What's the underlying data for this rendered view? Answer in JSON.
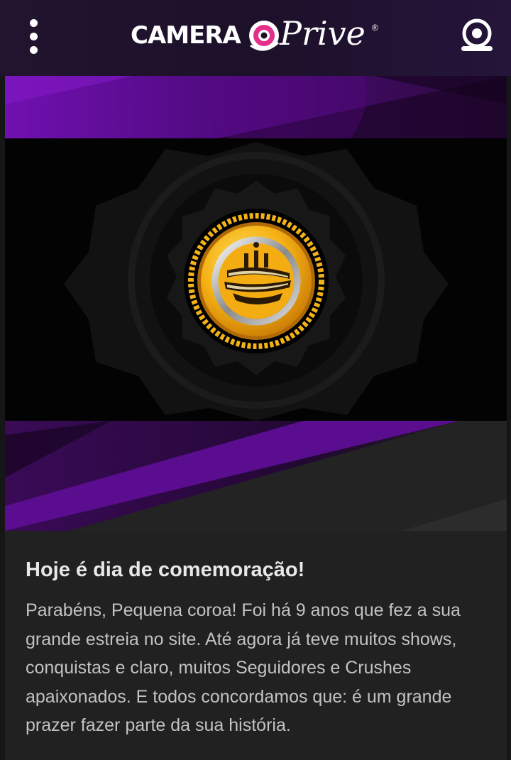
{
  "header": {
    "menu_icon": "vertical-dots-icon",
    "logo_left": "CAMERA",
    "logo_right": "Prive",
    "logo_registered": "®",
    "webcam_icon": "webcam-icon"
  },
  "banner": {
    "badge_icon": "gold-crown-coin-badge"
  },
  "article": {
    "title": "Hoje é dia de comemoração!",
    "body": "Parabéns, Pequena coroa! Foi há 9 anos que fez a sua grande estreia no site. Até agora já teve muitos shows, conquistas e claro, muitos Seguidores e Crushes apaixonados. E todos concordamos que: é um grande prazer fazer parte da sua história."
  },
  "colors": {
    "header_bg": "#1f122b",
    "card_bg": "#212121",
    "accent_purple": "#6a0fa3",
    "logo_pink": "#e4308a",
    "badge_gold": "#f2b318"
  }
}
